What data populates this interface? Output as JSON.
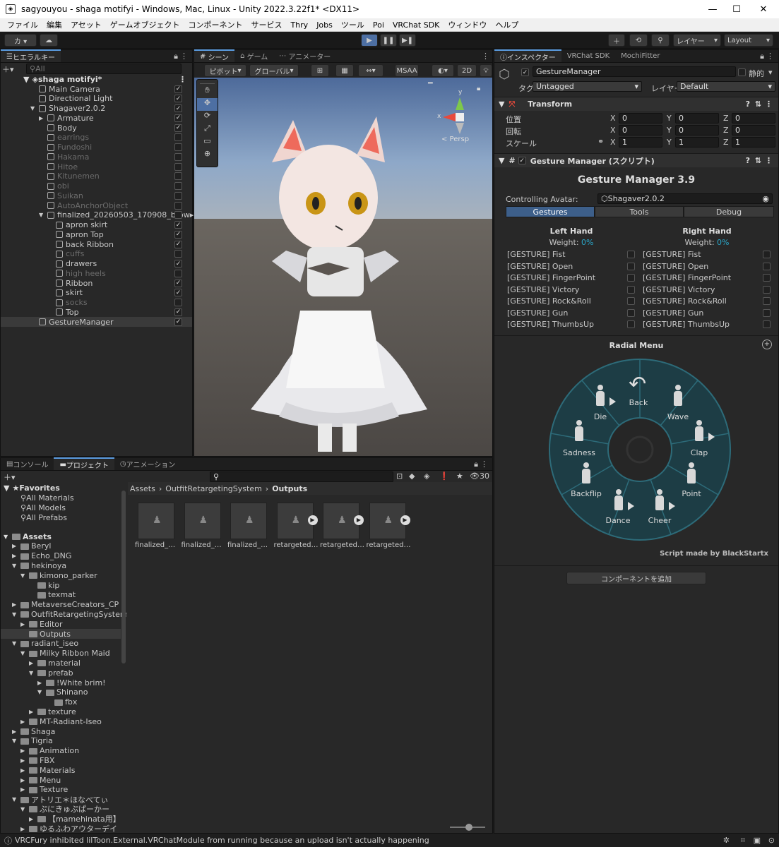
{
  "window": {
    "title": "sagyouyou - shaga motifyi - Windows, Mac, Linux - Unity 2022.3.22f1* <DX11>",
    "minimize": "—",
    "maximize": "☐",
    "close": "✕"
  },
  "menu": [
    "ファイル",
    "編集",
    "アセット",
    "ゲームオブジェクト",
    "コンポーネント",
    "サービス",
    "Thry",
    "Jobs",
    "ツール",
    "Poi",
    "VRChat SDK",
    "ウィンドウ",
    "ヘルプ"
  ],
  "toolbar": {
    "account": "カ ▾",
    "layers": "レイヤー",
    "layout": "Layout"
  },
  "hierarchy": {
    "tab": "ヒエラルキー",
    "search_placeholder": "All",
    "scene": "shaga motifyi*",
    "items": [
      {
        "label": "Main Camera",
        "indent": 1,
        "checked": true,
        "dim": false,
        "arrow": ""
      },
      {
        "label": "Directional Light",
        "indent": 1,
        "checked": true,
        "dim": false,
        "arrow": ""
      },
      {
        "label": "Shagaver2.0.2",
        "indent": 1,
        "checked": true,
        "dim": false,
        "arrow": "▼"
      },
      {
        "label": "Armature",
        "indent": 2,
        "checked": true,
        "dim": false,
        "arrow": "▶"
      },
      {
        "label": "Body",
        "indent": 2,
        "checked": true,
        "dim": false,
        "arrow": ""
      },
      {
        "label": "earrings",
        "indent": 2,
        "checked": false,
        "dim": true,
        "arrow": ""
      },
      {
        "label": "Fundoshi",
        "indent": 2,
        "checked": false,
        "dim": true,
        "arrow": ""
      },
      {
        "label": "Hakama",
        "indent": 2,
        "checked": false,
        "dim": true,
        "arrow": ""
      },
      {
        "label": "Hitoe",
        "indent": 2,
        "checked": false,
        "dim": true,
        "arrow": ""
      },
      {
        "label": "Kitunemen",
        "indent": 2,
        "checked": false,
        "dim": true,
        "arrow": ""
      },
      {
        "label": "obi",
        "indent": 2,
        "checked": false,
        "dim": true,
        "arrow": ""
      },
      {
        "label": "Suikan",
        "indent": 2,
        "checked": false,
        "dim": true,
        "arrow": ""
      },
      {
        "label": "AutoAnchorObject",
        "indent": 2,
        "checked": false,
        "dim": true,
        "arrow": ""
      },
      {
        "label": "finalized_20260503_170908_brow▸ C",
        "indent": 2,
        "checked": false,
        "dim": false,
        "arrow": "▼"
      },
      {
        "label": "apron skirt",
        "indent": 3,
        "checked": true,
        "dim": false,
        "arrow": ""
      },
      {
        "label": "apron Top",
        "indent": 3,
        "checked": true,
        "dim": false,
        "arrow": ""
      },
      {
        "label": "back Ribbon",
        "indent": 3,
        "checked": true,
        "dim": false,
        "arrow": ""
      },
      {
        "label": "cuffs",
        "indent": 3,
        "checked": false,
        "dim": true,
        "arrow": ""
      },
      {
        "label": "drawers",
        "indent": 3,
        "checked": true,
        "dim": false,
        "arrow": ""
      },
      {
        "label": "high heels",
        "indent": 3,
        "checked": false,
        "dim": true,
        "arrow": ""
      },
      {
        "label": "Ribbon",
        "indent": 3,
        "checked": true,
        "dim": false,
        "arrow": ""
      },
      {
        "label": "skirt",
        "indent": 3,
        "checked": true,
        "dim": false,
        "arrow": ""
      },
      {
        "label": "socks",
        "indent": 3,
        "checked": false,
        "dim": true,
        "arrow": ""
      },
      {
        "label": "Top",
        "indent": 3,
        "checked": true,
        "dim": false,
        "arrow": ""
      },
      {
        "label": "GestureManager",
        "indent": 1,
        "checked": true,
        "dim": false,
        "arrow": "",
        "selected": true
      }
    ]
  },
  "scene": {
    "tabs": [
      "シーン",
      "ゲーム",
      "アニメーター"
    ],
    "pivot": "ピボット",
    "global": "グローバル",
    "msaa": "MSAA",
    "mode2d": "2D",
    "persp": "< Persp",
    "axis_y": "y",
    "axis_x": "x"
  },
  "inspector": {
    "tabs": [
      "インスペクター",
      "VRChat SDK",
      "MochiFitter"
    ],
    "object_name": "GestureManager",
    "static": "静的",
    "tag_label": "タグ",
    "tag_value": "Untagged",
    "layer_label": "レイヤー",
    "layer_value": "Default",
    "transform": {
      "title": "Transform",
      "rows": [
        {
          "label": "位置",
          "x": "0",
          "y": "0",
          "z": "0"
        },
        {
          "label": "回転",
          "x": "0",
          "y": "0",
          "z": "0"
        },
        {
          "label": "スケール",
          "x": "1",
          "y": "1",
          "z": "1"
        }
      ]
    },
    "gm": {
      "title": "Gesture Manager (スクリプト)",
      "heading": "Gesture Manager 3.9",
      "controlling_label": "Controlling Avatar:",
      "controlling_value": "Shagaver2.0.2",
      "tabs": [
        "Gestures",
        "Tools",
        "Debug"
      ],
      "left_hand": "Left Hand",
      "right_hand": "Right Hand",
      "weight_label": "Weight:",
      "weight_value": "0%",
      "gestures": [
        "[GESTURE] Fist",
        "[GESTURE] Open",
        "[GESTURE] FingerPoint",
        "[GESTURE] Victory",
        "[GESTURE] Rock&Roll",
        "[GESTURE] Gun",
        "[GESTURE] ThumbsUp"
      ],
      "radial_title": "Radial Menu",
      "radial_items": [
        {
          "label": "Back"
        },
        {
          "label": "Wave"
        },
        {
          "label": "Clap"
        },
        {
          "label": "Point"
        },
        {
          "label": "Cheer"
        },
        {
          "label": "Dance"
        },
        {
          "label": "Backflip"
        },
        {
          "label": "Sadness"
        },
        {
          "label": "Die"
        }
      ],
      "credit": "Script made by BlackStartx"
    },
    "add_component": "コンポーネントを追加"
  },
  "project": {
    "tabs": [
      "コンソール",
      "プロジェクト",
      "アニメーション"
    ],
    "count": "30",
    "favorites": "Favorites",
    "fav_items": [
      "All Materials",
      "All Models",
      "All Prefabs"
    ],
    "breadcrumb": [
      "Assets",
      "OutfitRetargetingSystem",
      "Outputs"
    ],
    "tree": [
      {
        "label": "Assets",
        "indent": 0,
        "arrow": "▼",
        "bold": true
      },
      {
        "label": "Beryl",
        "indent": 1,
        "arrow": "▶"
      },
      {
        "label": "Echo_DNG",
        "indent": 1,
        "arrow": "▶"
      },
      {
        "label": "hekinoya",
        "indent": 1,
        "arrow": "▼"
      },
      {
        "label": "kimono_parker",
        "indent": 2,
        "arrow": "▼"
      },
      {
        "label": "kip",
        "indent": 3,
        "arrow": ""
      },
      {
        "label": "texmat",
        "indent": 3,
        "arrow": ""
      },
      {
        "label": "MetaverseCreators_CP",
        "indent": 1,
        "arrow": "▶"
      },
      {
        "label": "OutfitRetargetingSystem",
        "indent": 1,
        "arrow": "▼"
      },
      {
        "label": "Editor",
        "indent": 2,
        "arrow": "▶"
      },
      {
        "label": "Outputs",
        "indent": 2,
        "arrow": "",
        "selected": true
      },
      {
        "label": "radiant_iseo",
        "indent": 1,
        "arrow": "▼"
      },
      {
        "label": "Milky Ribbon Maid",
        "indent": 2,
        "arrow": "▼"
      },
      {
        "label": "material",
        "indent": 3,
        "arrow": "▶"
      },
      {
        "label": "prefab",
        "indent": 3,
        "arrow": "▼"
      },
      {
        "label": "!White brim!",
        "indent": 4,
        "arrow": "▶"
      },
      {
        "label": "Shinano",
        "indent": 4,
        "arrow": "▼"
      },
      {
        "label": "fbx",
        "indent": 5,
        "arrow": ""
      },
      {
        "label": "texture",
        "indent": 3,
        "arrow": "▶"
      },
      {
        "label": "MT-Radiant-Iseo",
        "indent": 2,
        "arrow": "▶"
      },
      {
        "label": "Shaga",
        "indent": 1,
        "arrow": "▶"
      },
      {
        "label": "Tigria",
        "indent": 1,
        "arrow": "▼"
      },
      {
        "label": "Animation",
        "indent": 2,
        "arrow": "▶"
      },
      {
        "label": "FBX",
        "indent": 2,
        "arrow": "▶"
      },
      {
        "label": "Materials",
        "indent": 2,
        "arrow": "▶"
      },
      {
        "label": "Menu",
        "indent": 2,
        "arrow": "▶"
      },
      {
        "label": "Texture",
        "indent": 2,
        "arrow": "▶"
      },
      {
        "label": "アトリエ＊ほなべてぃ",
        "indent": 1,
        "arrow": "▼"
      },
      {
        "label": "ぷにきゅぷぱーかー",
        "indent": 2,
        "arrow": "▼"
      },
      {
        "label": "【mamehinata用】",
        "indent": 3,
        "arrow": "▶"
      },
      {
        "label": "ゆるふわアウターデイ",
        "indent": 2,
        "arrow": "▶"
      }
    ],
    "assets": [
      "finalized_…",
      "finalized_…",
      "finalized_…",
      "retargeted…",
      "retargeted…",
      "retargeted…"
    ]
  },
  "status": "VRCFury inhibited lilToon.External.VRChatModule from running because an upload isn't actually happening"
}
